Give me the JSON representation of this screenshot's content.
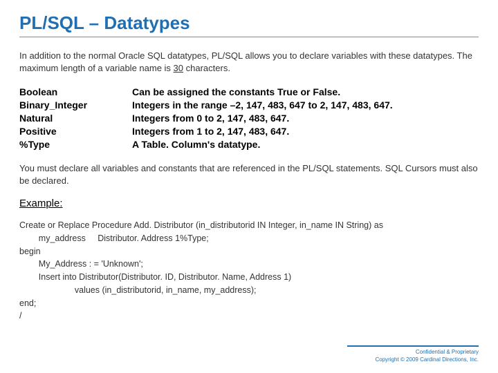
{
  "title": "PL/SQL – Datatypes",
  "intro_part1": "In addition to the normal Oracle SQL datatypes, PL/SQL allows you to declare variables with these datatypes.  The maximum length of a variable name is ",
  "intro_underlined": "30",
  "intro_part2": " characters.",
  "datatypes": [
    {
      "name": "Boolean",
      "desc": "Can be assigned the constants True or False."
    },
    {
      "name": "Binary_Integer",
      "desc": "Integers in the range –2, 147, 483, 647 to 2, 147, 483, 647."
    },
    {
      "name": "Natural",
      "desc": "Integers from 0 to 2, 147, 483, 647."
    },
    {
      "name": "Positive",
      "desc": "Integers from 1 to 2, 147, 483, 647."
    },
    {
      "name": "%Type",
      "desc": "A Table. Column's datatype."
    }
  ],
  "note": "You must declare all variables and constants that are referenced in the PL/SQL statements.  SQL Cursors must also be declared.",
  "example_label": "Example:",
  "code": "Create or Replace Procedure Add. Distributor (in_distributorid IN Integer, in_name IN String) as\n        my_address     Distributor. Address 1%Type;\nbegin\n        My_Address : = 'Unknown';\n        Insert into Distributor(Distributor. ID, Distributor. Name, Address 1)\n                       values (in_distributorid, in_name, my_address);\nend;\n/",
  "footer_line1": "Confidential & Proprietary",
  "footer_line2": "Copyright © 2009 Cardinal Directions, Inc."
}
